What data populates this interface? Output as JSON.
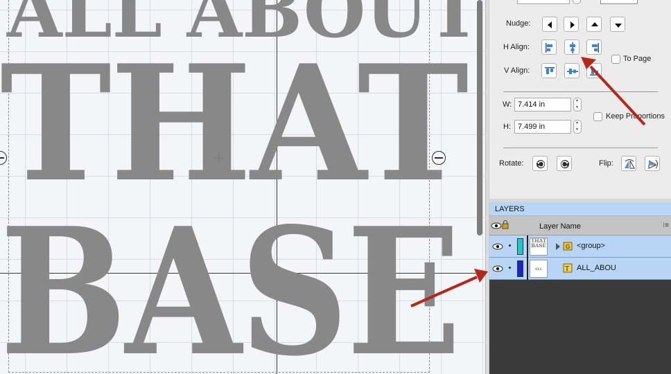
{
  "canvas": {
    "line1": "ALL ABOUT",
    "line2": "THAT",
    "line3": "BASE"
  },
  "panel": {
    "nudge_label": "Nudge:",
    "h_align_label": "H Align:",
    "v_align_label": "V Align:",
    "to_page_label": "To Page",
    "w_label": "W:",
    "w_value": "7.414 in",
    "h_label": "H:",
    "h_value": "7.499 in",
    "keep_proportions_label": "Keep Proportions",
    "rotate_label": "Rotate:",
    "flip_label": "Flip:"
  },
  "layers": {
    "title": "LAYERS",
    "column_header": "Layer Name",
    "rows": [
      {
        "name": "<group>",
        "thumb": "THAT BASE",
        "color": "#1fc8c8",
        "icon": "group-folder-icon",
        "expandable": true
      },
      {
        "name": "ALL_ABOU",
        "thumb": "ALL ABOUT",
        "color": "#1228c8",
        "icon": "text-layer-icon",
        "expandable": false
      }
    ]
  },
  "colors": {
    "text_gray": "#888888",
    "arrow_red": "#b5271a",
    "layer_selected": "#b8d5f5"
  }
}
